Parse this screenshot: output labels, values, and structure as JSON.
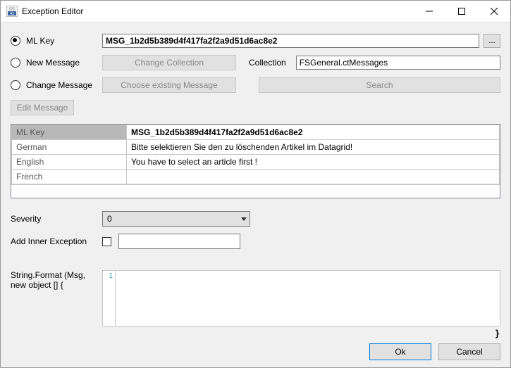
{
  "window": {
    "title": "Exception Editor"
  },
  "mode": {
    "mlkey_label": "ML Key",
    "new_label": "New Message",
    "change_label": "Change Message"
  },
  "mlkey_value": "MSG_1b2d5b389d4f417fa2f2a9d51d6ac8e2",
  "dots_label": "...",
  "coll": {
    "change_btn": "Change Collection",
    "label": "Collection",
    "value": "FSGeneral.ctMessages"
  },
  "chg": {
    "choose_btn": "Choose existing Message",
    "search_btn": "Search"
  },
  "edit_msg_btn": "Edit Message",
  "msg_table": {
    "key_label": "ML Key",
    "key_value": "MSG_1b2d5b389d4f417fa2f2a9d51d6ac8e2",
    "rows": [
      {
        "lang": "German",
        "text": "Bitte selektieren Sie den zu löschenden Artikel im Datagrid!"
      },
      {
        "lang": "English",
        "text": "You have to select an article first !"
      },
      {
        "lang": "French",
        "text": ""
      }
    ]
  },
  "severity": {
    "label": "Severity",
    "value": "0"
  },
  "inner": {
    "label": "Add Inner Exception",
    "value": ""
  },
  "fmt": {
    "label": "String.Format (Msg, new object [] {",
    "line_no": "1",
    "closing": "}"
  },
  "footer": {
    "ok": "Ok",
    "cancel": "Cancel"
  }
}
